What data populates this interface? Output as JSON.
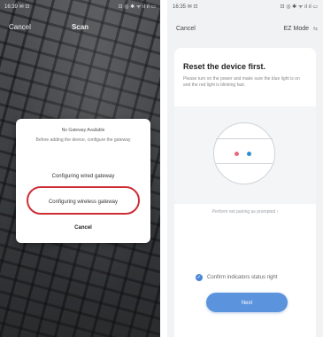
{
  "left_screen": {
    "status_bar": {
      "time": "16:39 ✉ ⊡",
      "icons": "⊡ ◎ ✱ ᯤ ıl ıl ▭"
    },
    "header": {
      "cancel_label": "Cancel",
      "title": "Scan"
    },
    "sheet": {
      "title": "No Gateway Available",
      "description": "Before adding the device, configure the gateway",
      "options": [
        {
          "label": "Configuring wired gateway"
        },
        {
          "label": "Configuring wireless gateway"
        }
      ],
      "cancel_label": "Cancel"
    },
    "highlight_color": "#cf2d35"
  },
  "right_screen": {
    "status_bar": {
      "time": "16:35 ✉ ⊡",
      "icons": "⊡ ◎ ✱ ᯤ ıl ıl ▭"
    },
    "header": {
      "cancel_label": "Cancel",
      "mode_label": "EZ Mode",
      "mode_icon": "⇆"
    },
    "reset_title": "Reset the device first.",
    "reset_description": "Please turn on the power and make sure the blue light is on and the red light is blinking fast.",
    "pairing_link": "Perform net pairing as prompted ›",
    "confirm_label": "Confirm indicators status right",
    "next_label": "Next",
    "accent_color": "#5b93dd"
  }
}
